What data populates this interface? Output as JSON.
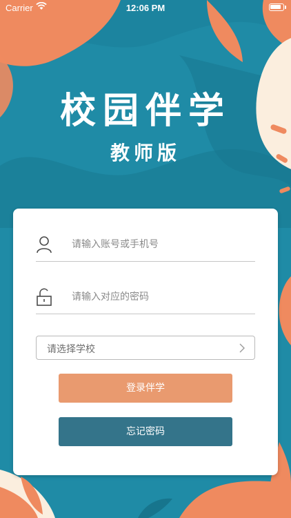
{
  "status_bar": {
    "carrier": "Carrier",
    "time": "12:06 PM"
  },
  "header": {
    "title": "校园伴学",
    "subtitle": "教师版"
  },
  "login_form": {
    "account_placeholder": "请输入账号或手机号",
    "password_placeholder": "请输入对应的密码",
    "school_select_label": "请选择学校",
    "login_button": "登录伴学",
    "forgot_button": "忘记密码"
  },
  "colors": {
    "background": "#1f8ba6",
    "accent_orange": "#ef8a5f",
    "cream": "#fbeede",
    "login_button": "#e99a6f",
    "forgot_button": "#34748a"
  }
}
